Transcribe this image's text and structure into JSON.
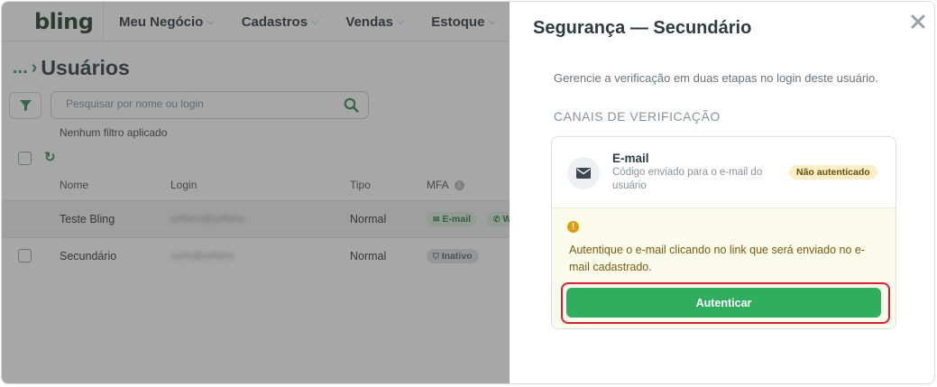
{
  "topbar": {
    "logo": "bling",
    "nav": [
      {
        "label": "Meu Negócio"
      },
      {
        "label": "Cadastros"
      },
      {
        "label": "Vendas"
      },
      {
        "label": "Estoque"
      }
    ]
  },
  "page": {
    "breadcrumb_dots": "...",
    "title": "Usuários"
  },
  "search": {
    "placeholder": "Pesquisar por nome ou login"
  },
  "filters": {
    "status": "Nenhum filtro aplicado"
  },
  "table": {
    "headers": {
      "name": "Nome",
      "login": "Login",
      "type": "Tipo",
      "mfa": "MFA"
    },
    "rows": [
      {
        "name": "Teste Bling",
        "login": "zeflaho@zeflaho",
        "type": "Normal",
        "mfa": [
          "E-mail",
          "W"
        ]
      },
      {
        "name": "Secundário",
        "login": "carlo@zeflaho",
        "type": "Normal",
        "mfa": [
          "Inativo"
        ]
      }
    ]
  },
  "drawer": {
    "title": "Segurança — Secundário",
    "description": "Gerencie a verificação em duas etapas no login deste usuário.",
    "section": "CANAIS DE VERIFICAÇÃO",
    "channel": {
      "title": "E-mail",
      "subtitle": "Código enviado para o e-mail do usuário",
      "status": "Não autenticado"
    },
    "warning": {
      "icon": "!",
      "text": "Autentique o e-mail clicando no link que será enviado no e-mail cadastrado."
    },
    "button": "Autenticar"
  },
  "colors": {
    "brand_green": "#2fae5f",
    "highlight_red": "#d9202f",
    "warning_bg": "#fbfbec",
    "status_bg": "#fbeec9"
  },
  "icons": {
    "filter": "filter-icon",
    "search": "search-icon",
    "refresh": "refresh-icon",
    "info": "info-icon",
    "close": "close-icon",
    "envelope": "envelope-icon",
    "warning": "warning-icon"
  }
}
